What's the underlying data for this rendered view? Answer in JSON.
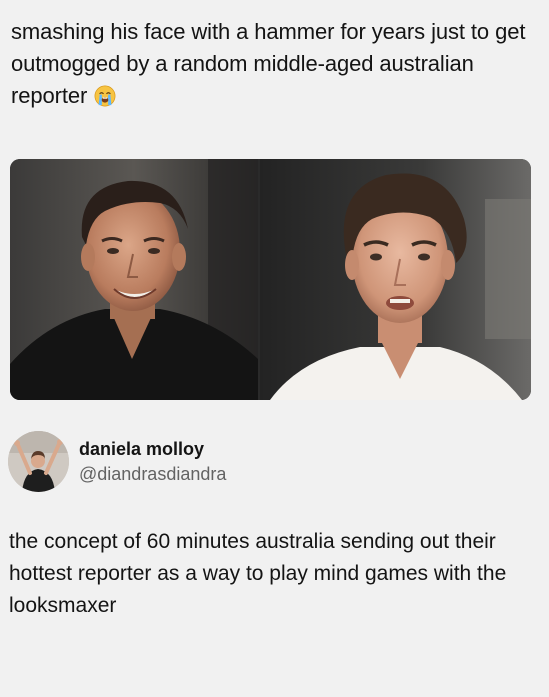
{
  "caption": {
    "text": "smashing his face with a hammer for years just to get outmogged by a random middle-aged australian reporter",
    "emoji_icon": "loudly-crying-face-emoji"
  },
  "photos": {
    "left_icon": "photo-smiling-man-dark-shirt",
    "right_icon": "photo-young-man-white-shirt"
  },
  "tweet": {
    "display_name": "daniela molloy",
    "handle": "@diandrasdiandra",
    "avatar_icon": "avatar-person-arms-raised",
    "text": "the concept of 60 minutes australia sending out their hottest reporter as a way to play mind games with the looksmaxer"
  },
  "colors": {
    "background": "#f1f1f1",
    "text_primary": "#141414",
    "text_secondary": "#636363"
  }
}
